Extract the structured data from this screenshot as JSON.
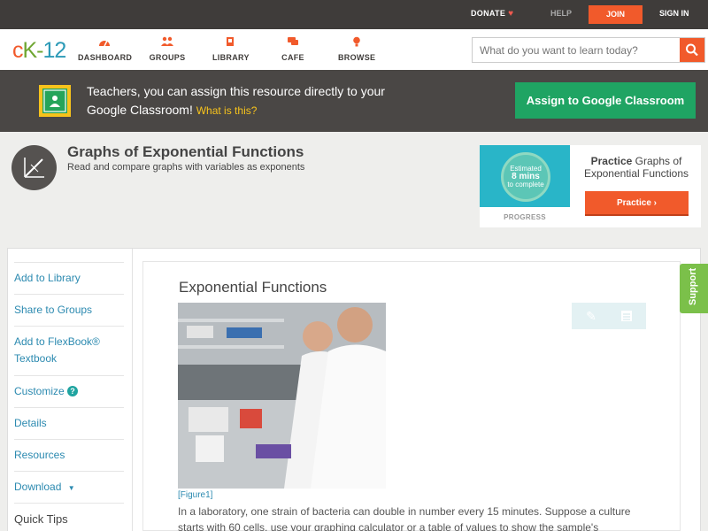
{
  "topbar": {
    "donate": "DONATE",
    "help": "HELP",
    "join": "JOIN",
    "signin": "SIGN IN"
  },
  "header": {
    "logo": {
      "c": "c",
      "k": "K-",
      "n": "12"
    },
    "nav": [
      {
        "label": "DASHBOARD",
        "icon": "dashboard-icon"
      },
      {
        "label": "GROUPS",
        "icon": "groups-icon"
      },
      {
        "label": "LIBRARY",
        "icon": "library-icon"
      },
      {
        "label": "CAFE",
        "icon": "cafe-icon"
      },
      {
        "label": "BROWSE",
        "icon": "browse-icon"
      }
    ],
    "search_placeholder": "What do you want to learn today?"
  },
  "classroom": {
    "text": "Teachers, you can assign this resource directly to your Google Classroom!",
    "what": "What is this?",
    "button": "Assign to Google Classroom"
  },
  "concept": {
    "title": "Graphs of Exponential Functions",
    "subtitle": "Read and compare graphs with variables as exponents"
  },
  "practice": {
    "estimated": "Estimated",
    "mins": "8 mins",
    "complete": "to complete",
    "progress": "PROGRESS",
    "title_bold": "Practice",
    "title_rest": "Graphs of Exponential Functions",
    "button": "Practice"
  },
  "sidebar": {
    "items": [
      "Add to Library",
      "Share to Groups",
      "Add to FlexBook®",
      "Textbook",
      "Customize",
      "Details",
      "Resources",
      "Download",
      "Quick Tips"
    ]
  },
  "article": {
    "title": "Exponential Functions",
    "figure_caption": "[Figure1]",
    "paragraph": "In a laboratory, one strain of bacteria can double in number every 15 minutes. Suppose a culture starts with 60 cells, use your graphing calculator or a table of values to show the sample's"
  },
  "support": "Support",
  "colors": {
    "accent": "#f15a2b",
    "green": "#1fa463",
    "link": "#2c8ab0"
  }
}
